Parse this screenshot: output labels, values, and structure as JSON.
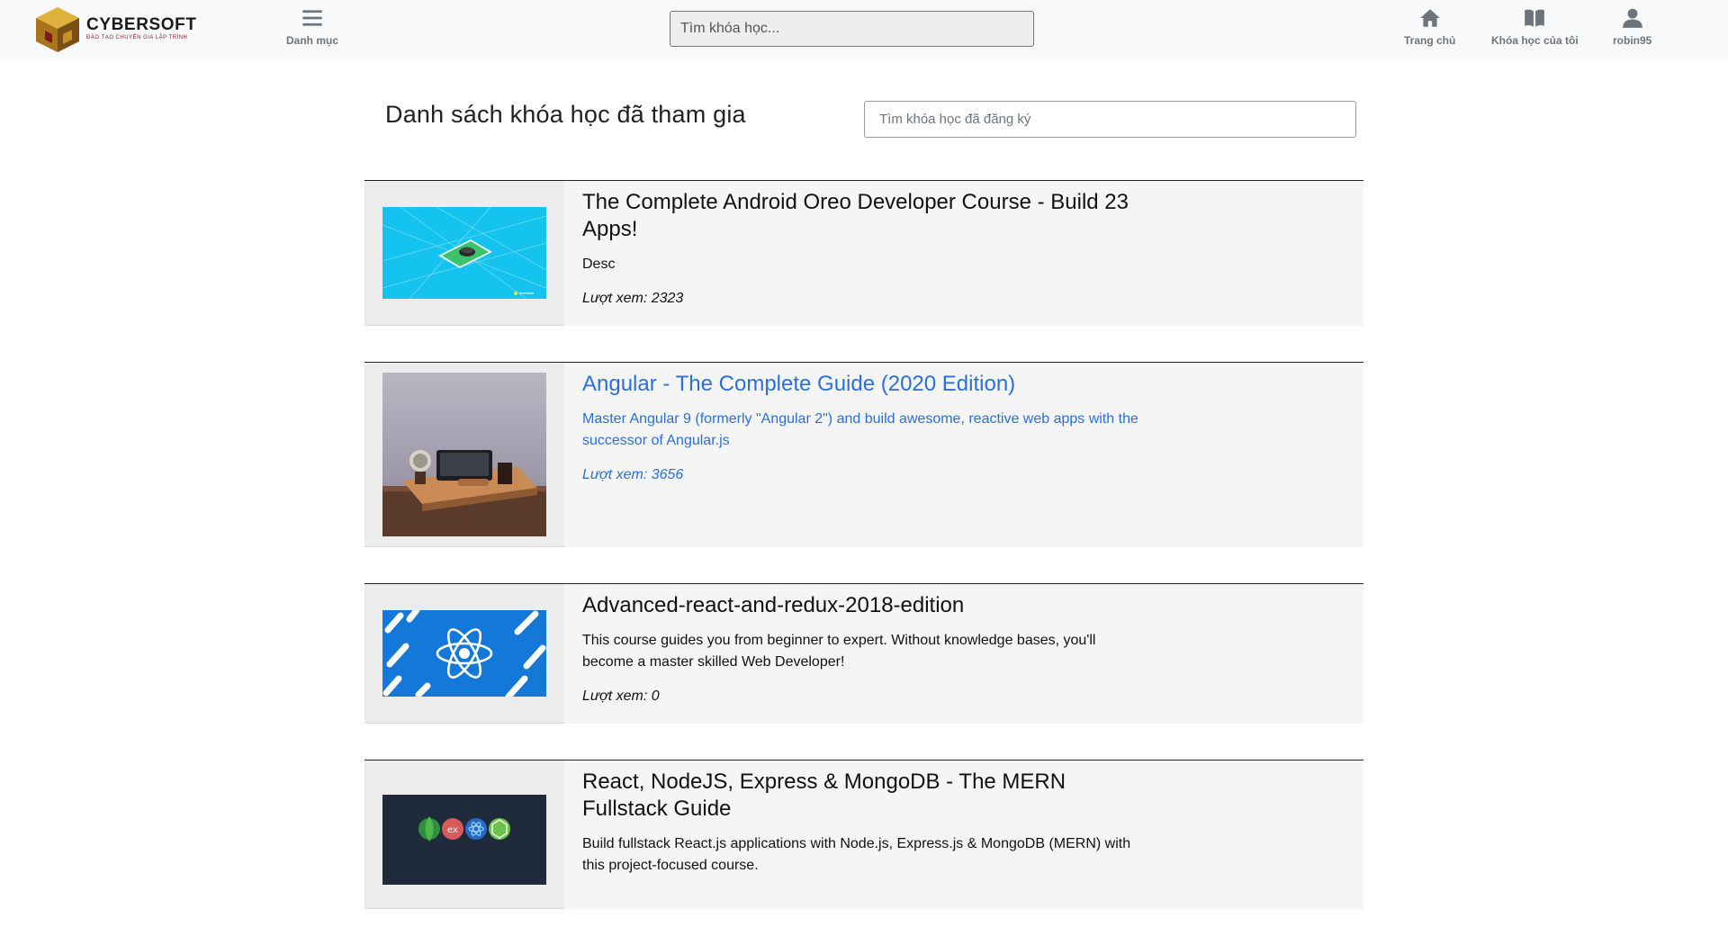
{
  "header": {
    "logo": {
      "name": "CYBERSOFT",
      "tagline": "ĐÀO TẠO CHUYÊN GIA LẬP TRÌNH"
    },
    "menu": {
      "label": "Danh mục",
      "icon": "hamburger-icon"
    },
    "search": {
      "placeholder": "Tìm khóa học..."
    },
    "nav": [
      {
        "label": "Trang chủ",
        "icon": "home-icon"
      },
      {
        "label": "Khóa học của tôi",
        "icon": "book-icon"
      },
      {
        "label": "robin95",
        "icon": "user-icon"
      }
    ]
  },
  "page": {
    "title": "Danh sách khóa học đã tham gia",
    "search_placeholder": "Tìm khóa học đã đăng ký"
  },
  "courses": [
    {
      "title": "The Complete Android Oreo Developer Course - Build 23 Apps!",
      "description": "Desc",
      "views": "Lượt xem: 2323",
      "thumbnail": "android-phone-illustration",
      "hovered": false
    },
    {
      "title": "Angular - The Complete Guide (2020 Edition)",
      "description": "Master Angular 9 (formerly \"Angular 2\") and build awesome, reactive web apps with the successor of Angular.js",
      "views": "Lượt xem: 3656",
      "thumbnail": "wooden-phone-dock-photo",
      "hovered": true
    },
    {
      "title": "Advanced-react-and-redux-2018-edition",
      "description": "This course guides you from beginner to expert. Without knowledge bases, you'll become a master skilled Web Developer!",
      "views": "Lượt xem: 0",
      "thumbnail": "react-atom-logo",
      "hovered": false
    },
    {
      "title": "React, NodeJS, Express & MongoDB - The MERN Fullstack Guide",
      "description": "Build fullstack React.js applications with Node.js, Express.js & MongoDB (MERN) with this project-focused course.",
      "views": "",
      "thumbnail": "mern-stack-logos",
      "hovered": false
    }
  ],
  "colors": {
    "hover_link": "#2a6fdb",
    "card_bg": "#f5f5f5",
    "header_bg": "#f8f9fa"
  }
}
